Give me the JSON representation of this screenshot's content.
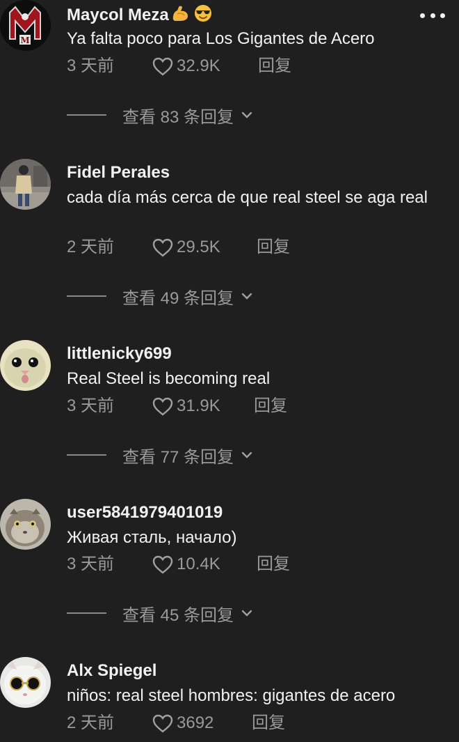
{
  "comments": [
    {
      "username": "Maycol Meza",
      "emojis": [
        "💪",
        "😎"
      ],
      "text": "Ya falta poco para Los Gigantes de Acero",
      "time": "3 天前",
      "likes": "32.9K",
      "reply_label": "回复",
      "view_replies": "查看 83 条回复"
    },
    {
      "username": "Fidel Perales",
      "text": "cada día más cerca de que real steel se aga real",
      "time": "2 天前",
      "likes": "29.5K",
      "reply_label": "回复",
      "view_replies": "查看 49 条回复"
    },
    {
      "username": "littlenicky699",
      "text": "Real Steel is becoming real",
      "time": "3 天前",
      "likes": "31.9K",
      "reply_label": "回复",
      "view_replies": "查看 77 条回复"
    },
    {
      "username": "user5841979401019",
      "text": "Живая сталь, начало)",
      "time": "3 天前",
      "likes": "10.4K",
      "reply_label": "回复",
      "view_replies": "查看 45 条回复"
    },
    {
      "username": "Alx Spiegel",
      "text": "niños: real steel hombres: gigantes de acero",
      "time": "2 天前",
      "likes": "3692",
      "reply_label": "回复"
    }
  ],
  "icons": {
    "more": "more-options-icon",
    "like": "heart-icon",
    "expand": "chevron-down-icon"
  },
  "colors": {
    "background": "#1f1f1f",
    "text_primary": "#f2f2f2",
    "text_secondary": "#9a9a9a"
  }
}
